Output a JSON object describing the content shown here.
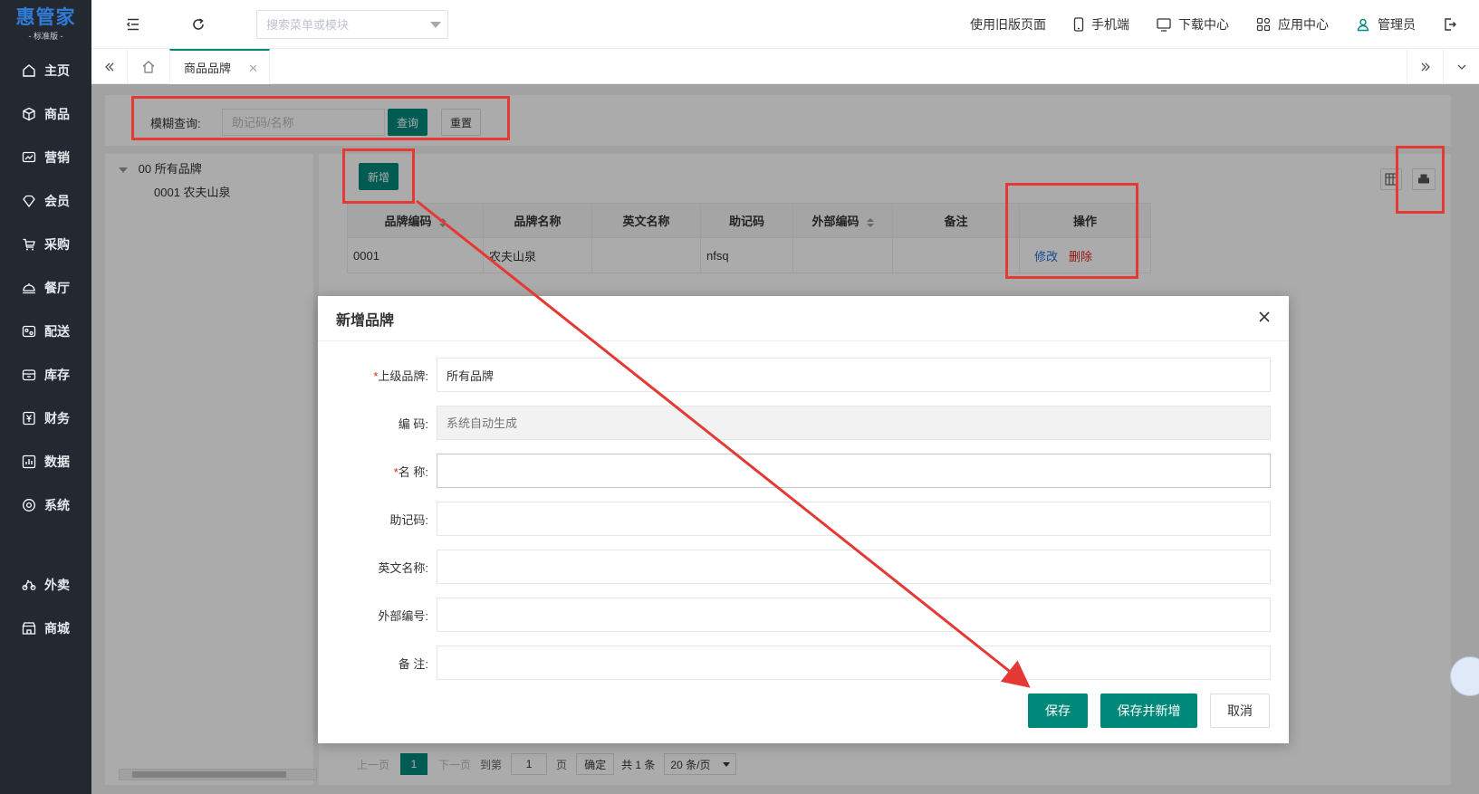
{
  "sidebar": {
    "logo_main": "惠管家",
    "logo_sub": "- 标准版 -",
    "items": [
      {
        "label": "主页",
        "icon": "home-icon"
      },
      {
        "label": "商品",
        "icon": "box-icon"
      },
      {
        "label": "营销",
        "icon": "chart-icon"
      },
      {
        "label": "会员",
        "icon": "diamond-icon"
      },
      {
        "label": "采购",
        "icon": "cart-icon"
      },
      {
        "label": "餐厅",
        "icon": "dish-icon"
      },
      {
        "label": "配送",
        "icon": "delivery-icon"
      },
      {
        "label": "库存",
        "icon": "inventory-icon"
      },
      {
        "label": "财务",
        "icon": "finance-icon"
      },
      {
        "label": "数据",
        "icon": "data-icon"
      },
      {
        "label": "系统",
        "icon": "system-icon"
      }
    ],
    "extra_items": [
      {
        "label": "外卖",
        "icon": "bike-icon"
      },
      {
        "label": "商城",
        "icon": "store-icon"
      }
    ]
  },
  "header": {
    "search_placeholder": "搜索菜单或模块",
    "links": {
      "old_version": "使用旧版页面",
      "mobile": "手机端",
      "download": "下载中心",
      "apps": "应用中心",
      "user": "管理员"
    }
  },
  "tabs": {
    "active": "商品品牌"
  },
  "filter": {
    "label": "模糊查询:",
    "placeholder": "助记码/名称",
    "query_btn": "查询",
    "reset_btn": "重置"
  },
  "tree": {
    "root": "00 所有品牌",
    "child": "0001 农夫山泉"
  },
  "toolbar": {
    "add_btn": "新增"
  },
  "table": {
    "headers": [
      "品牌编码",
      "品牌名称",
      "英文名称",
      "助记码",
      "外部编码",
      "备注",
      "操作"
    ],
    "rows": [
      {
        "code": "0001",
        "name": "农夫山泉",
        "en_name": "",
        "mnemonic": "nfsq",
        "ext_code": "",
        "remark": "",
        "edit": "修改",
        "delete": "删除"
      }
    ]
  },
  "pagination": {
    "prev": "上一页",
    "current": "1",
    "next": "下一页",
    "goto": "到第",
    "page_input": "1",
    "page_unit": "页",
    "confirm": "确定",
    "total": "共 1 条",
    "per_page": "20 条/页"
  },
  "modal": {
    "title": "新增品牌",
    "fields": {
      "parent": {
        "label": "上级品牌:",
        "value": "所有品牌"
      },
      "code": {
        "label": "编 码:",
        "placeholder": "系统自动生成"
      },
      "name": {
        "label": "名 称:",
        "value": ""
      },
      "mnemonic": {
        "label": "助记码:",
        "value": ""
      },
      "en_name": {
        "label": "英文名称:",
        "value": ""
      },
      "ext_code": {
        "label": "外部编号:",
        "value": ""
      },
      "remark": {
        "label": "备 注:",
        "value": ""
      }
    },
    "required_mark": "*",
    "save_btn": "保存",
    "save_new_btn": "保存并新增",
    "cancel_btn": "取消"
  },
  "colors": {
    "sidebar_bg": "#232831",
    "primary": "#00897b",
    "annotation": "#e53935",
    "link": "#1e6fd9",
    "danger": "#e1251b"
  }
}
